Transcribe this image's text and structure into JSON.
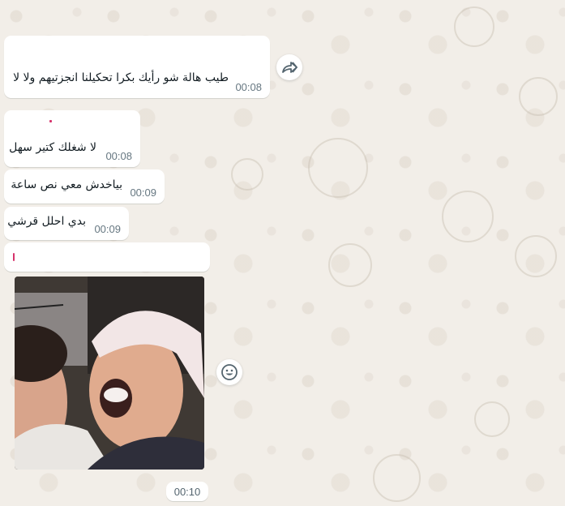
{
  "messages": [
    {
      "text": "طيب هالة شو رأيك بكرا تحكيلنا انجزتيهم ولا لا",
      "time": "00:08"
    },
    {
      "text": "لا شغلك كتير سهل",
      "time": "00:08"
    },
    {
      "text": "بياخدش معي نص ساعة",
      "time": "00:09"
    },
    {
      "text": "بدي احلل قرشي",
      "time": "00:09"
    }
  ],
  "image_message": {
    "time": "00:10",
    "image_alt": "photo"
  },
  "icons": {
    "forward": "forward-icon",
    "react": "emoji-reaction-icon"
  },
  "colors": {
    "background": "#efeae2",
    "bubble": "#ffffff",
    "text": "#111b21",
    "time": "#667781",
    "quote_accent": "#d6336c"
  }
}
